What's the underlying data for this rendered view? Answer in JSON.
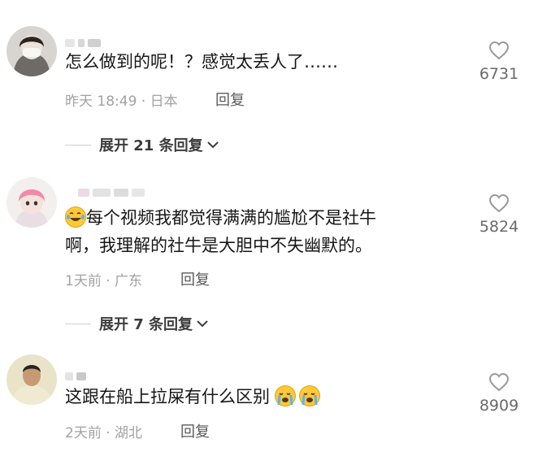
{
  "comments": [
    {
      "text": "怎么做到的呢！？感觉太丢人了……",
      "meta": "昨天 18:49 · 日本",
      "reply_label": "回复",
      "likes": "6731",
      "expand_label": "展开 21 条回复"
    },
    {
      "line1": "每个视频我都觉得满满的尴尬不是社牛",
      "line2": "啊，我理解的社牛是大胆中不失幽默的。",
      "meta": "1天前 · 广东",
      "reply_label": "回复",
      "likes": "5824",
      "expand_label": "展开 7 条回复",
      "leading_emoji": "laugh-cry-emoji"
    },
    {
      "text": "这跟在船上拉屎有什么区别",
      "meta": "2天前 · 湖北",
      "reply_label": "回复",
      "likes": "8909",
      "trailing_emoji": [
        "cry-emoji",
        "cry-emoji"
      ]
    }
  ],
  "icons": {
    "like": "heart-outline-icon",
    "expand": "chevron-down-icon"
  },
  "colors": {
    "text": "#161616",
    "meta": "#a2a2a2",
    "like_count": "#6a6a6a",
    "divider": "#cfcfcf",
    "emoji": "#ffc83d"
  }
}
